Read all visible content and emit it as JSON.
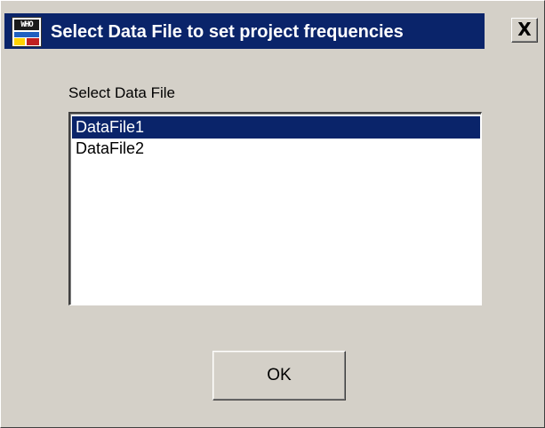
{
  "window": {
    "title": "Select Data File to set project frequencies",
    "close_symbol": "X",
    "icon": {
      "name": "app-icon",
      "text": "WHO"
    }
  },
  "form": {
    "label": "Select Data File",
    "list": {
      "items": [
        {
          "label": "DataFile1",
          "selected": true
        },
        {
          "label": "DataFile2",
          "selected": false
        }
      ]
    },
    "ok_label": "OK"
  },
  "colors": {
    "face": "#d4d0c8",
    "selection": "#0a246a",
    "title_active": "#0a246a"
  }
}
